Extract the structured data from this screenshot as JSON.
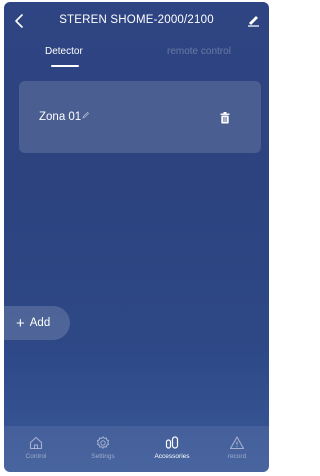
{
  "header": {
    "title": "STEREN SHOME-2000/2100",
    "back_icon": "chevron-left-icon",
    "edit_icon": "pencil-icon"
  },
  "tabs": [
    {
      "label": "Detector",
      "active": true
    },
    {
      "label": "remote control",
      "active": false
    }
  ],
  "zones": [
    {
      "name": "Zona 01",
      "edit_icon": "pencil-icon",
      "delete_icon": "trash-icon"
    }
  ],
  "add_button": {
    "label": "Add",
    "icon": "plus-icon"
  },
  "bottom_nav": [
    {
      "label": "Control",
      "icon": "home-icon",
      "active": false
    },
    {
      "label": "Settings",
      "icon": "gear-icon",
      "active": false
    },
    {
      "label": "Accessories",
      "icon": "accessories-icon",
      "active": true
    },
    {
      "label": "record",
      "icon": "warning-icon",
      "active": false
    }
  ],
  "colors": {
    "background_top": "#2f4583",
    "background_bottom": "#3a5898",
    "text": "#ffffff",
    "inactive_tab": "rgba(255,255,255,0.28)"
  }
}
